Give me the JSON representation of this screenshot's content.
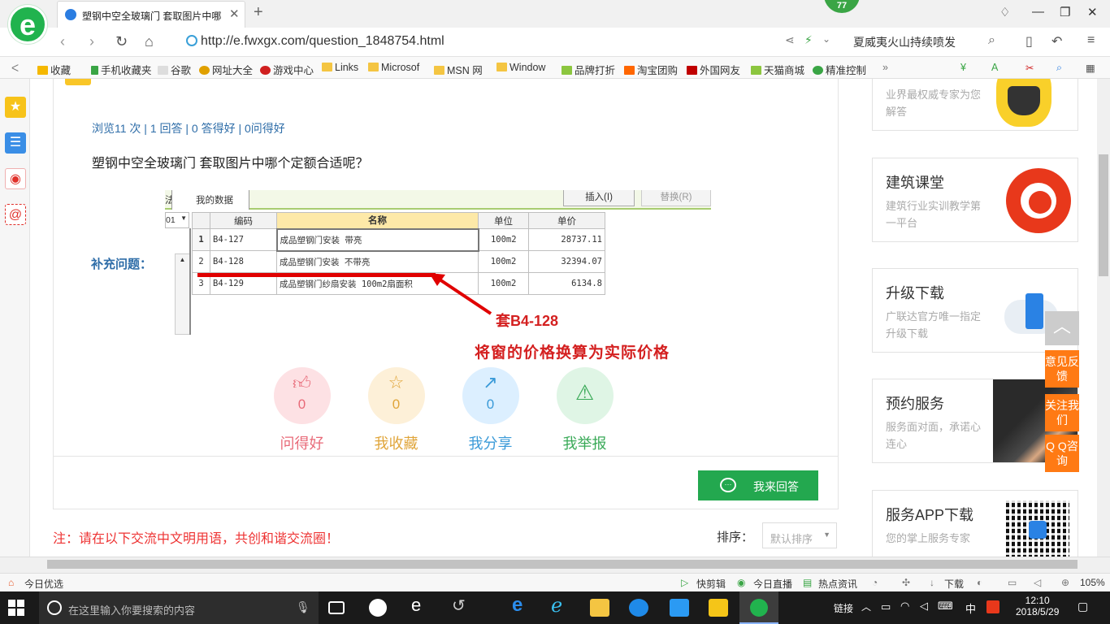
{
  "browser": {
    "tab_title": "塑钢中空全玻璃门 套取图片中哪",
    "badge": "77",
    "url_host": "http://e.fwxgx.com",
    "url_path": "/question_1848754.html",
    "search_text": "夏威夷火山持续喷发"
  },
  "bookmarks": [
    "收藏",
    "手机收藏夹",
    "谷歌",
    "网址大全",
    "游戏中心",
    "Links",
    "Microsof",
    "MSN 网",
    "Window",
    "品牌打折",
    "淘宝团购",
    "外国网友",
    "天猫商城",
    "精准控制"
  ],
  "question": {
    "stats": "浏览11 次 | 1 回答 | 0 答得好 | 0问得好",
    "title": "塑钢中空全玻璃门  套取图片中哪个定额合适呢？",
    "supplement_label": "补充问题："
  },
  "screenshot": {
    "tab_left": "法",
    "tab_mydata": "我的数据",
    "btn_insert": "插入(I)",
    "btn_replace": "替换(R)",
    "combo": "01",
    "headers": [
      "",
      "编码",
      "名称",
      "单位",
      "单价"
    ],
    "rows": [
      {
        "no": "1",
        "code": "B4-127",
        "name": "成品塑钢门安装 带亮",
        "unit": "100m2",
        "price": "28737.11"
      },
      {
        "no": "2",
        "code": "B4-128",
        "name": "成品塑钢门安装 不带亮",
        "unit": "100m2",
        "price": "32394.07"
      },
      {
        "no": "3",
        "code": "B4-129",
        "name": "成品塑钢门纱扇安装 100m2扇面积",
        "unit": "100m2",
        "price": "6134.8"
      }
    ],
    "annotation_1": "套B4-128",
    "annotation_2": "将窗的价格换算为实际价格",
    "annotation_color": "#d42020"
  },
  "actions": [
    {
      "label": "问得好",
      "count": "0",
      "icon": "thumbs-up-icon",
      "color": "#e86a78",
      "bg": "#fde1e4"
    },
    {
      "label": "我收藏",
      "count": "0",
      "icon": "star-icon",
      "color": "#e0a53a",
      "bg": "#fdf0d8"
    },
    {
      "label": "我分享",
      "count": "0",
      "icon": "share-icon",
      "color": "#3a9ad8",
      "bg": "#dcefff"
    },
    {
      "label": "我举报",
      "count": "",
      "icon": "warning-icon",
      "color": "#3aaa58",
      "bg": "#dff5e5"
    }
  ],
  "answer_button": "我来回答",
  "notice": "注：请在以下交流中文明用语，共创和谐交流圈！",
  "sort": {
    "label": "排序：",
    "value": "默认排序"
  },
  "sidebar_cards": [
    {
      "title": "",
      "sub": "业界最权威专家为您解答"
    },
    {
      "title": "建筑课堂",
      "sub": "建筑行业实训教学第一平台"
    },
    {
      "title": "升级下载",
      "sub": "广联达官方唯一指定升级下载"
    },
    {
      "title": "预约服务",
      "sub": "服务面对面，承诺心连心"
    },
    {
      "title": "服务APP下载",
      "sub": "您的掌上服务专家"
    }
  ],
  "float_buttons": [
    "意见反馈",
    "关注我们",
    "Q Q咨询"
  ],
  "statusbar": {
    "left": "今日优选",
    "items": [
      "快剪辑",
      "今日直播",
      "热点资讯",
      "下载"
    ],
    "zoom": "105%"
  },
  "taskbar": {
    "search_placeholder": "在这里输入你要搜索的内容",
    "tray_link": "链接",
    "ime": "中",
    "time": "12:10",
    "date": "2018/5/29"
  }
}
